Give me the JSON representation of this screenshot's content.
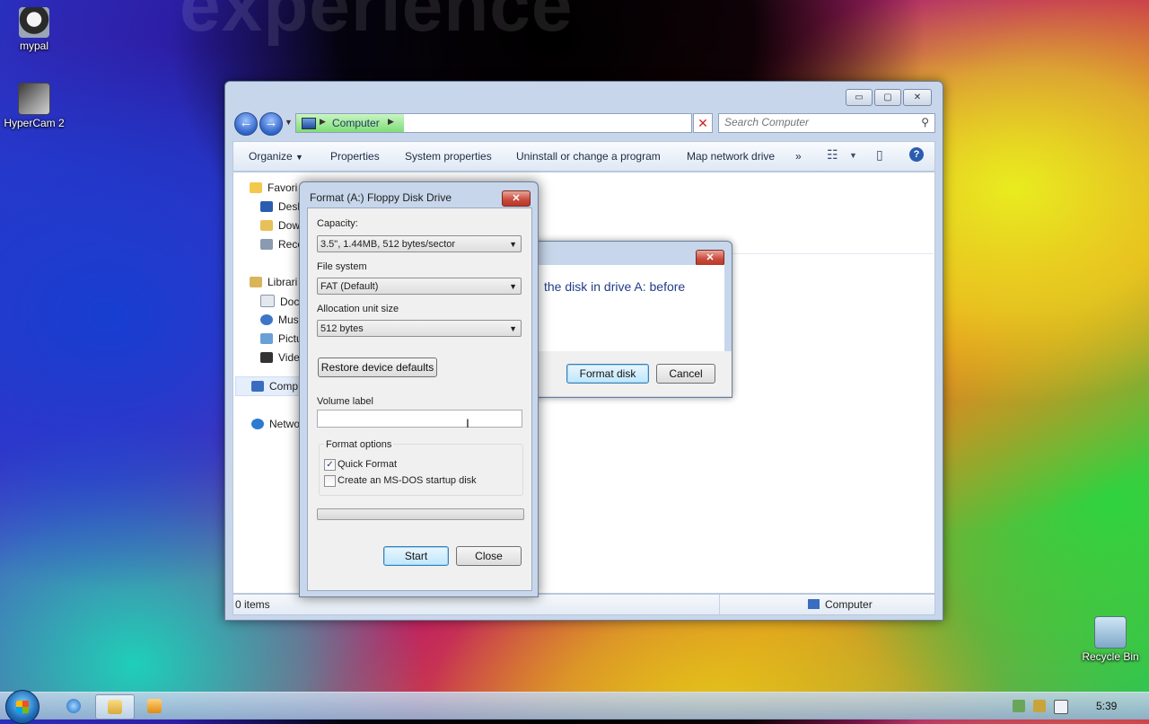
{
  "background_text": "experience",
  "desktop": {
    "icons": [
      {
        "label": "mypal"
      },
      {
        "label": "HyperCam 2"
      },
      {
        "label": "Recycle Bin"
      }
    ]
  },
  "explorer": {
    "address": {
      "crumb": "Computer",
      "placeholder": "Search Computer"
    },
    "caption_buttons": {
      "minimize": "▭",
      "maximize": "▢",
      "close": "✕"
    },
    "toolbar": {
      "organize": "Organize",
      "properties": "Properties",
      "system_properties": "System properties",
      "uninstall": "Uninstall or change a program",
      "map_drive": "Map network drive",
      "more": "»",
      "help": "?"
    },
    "nav": {
      "favorites": "Favori",
      "desktop": "Desk",
      "downloads": "Dow",
      "recent": "Rece",
      "libraries": "Librari",
      "documents": "Docu",
      "music": "Mus",
      "pictures": "Pictu",
      "videos": "Vide",
      "computer": "Comp",
      "network": "Netwo"
    },
    "status": {
      "items": "0 items",
      "location": "Computer"
    }
  },
  "confirm_dialog": {
    "close": "✕",
    "message": "the disk in drive A: before",
    "format_disk": "Format disk",
    "cancel": "Cancel"
  },
  "format_dialog": {
    "title": "Format (A:) Floppy Disk Drive",
    "close": "✕",
    "capacity_label": "Capacity:",
    "capacity_value": "3.5\",  1.44MB, 512 bytes/sector",
    "filesystem_label": "File system",
    "filesystem_value": "FAT (Default)",
    "allocation_label": "Allocation unit size",
    "allocation_value": "512 bytes",
    "restore_defaults": "Restore device defaults",
    "volume_label": "Volume label",
    "volume_value": "",
    "format_options": "Format options",
    "quick_format": "Quick Format",
    "quick_format_checked": true,
    "msdos_startup": "Create an MS-DOS startup disk",
    "msdos_startup_checked": false,
    "progress": 0,
    "start": "Start",
    "close_button": "Close"
  },
  "taskbar": {
    "clock": "5:39"
  }
}
